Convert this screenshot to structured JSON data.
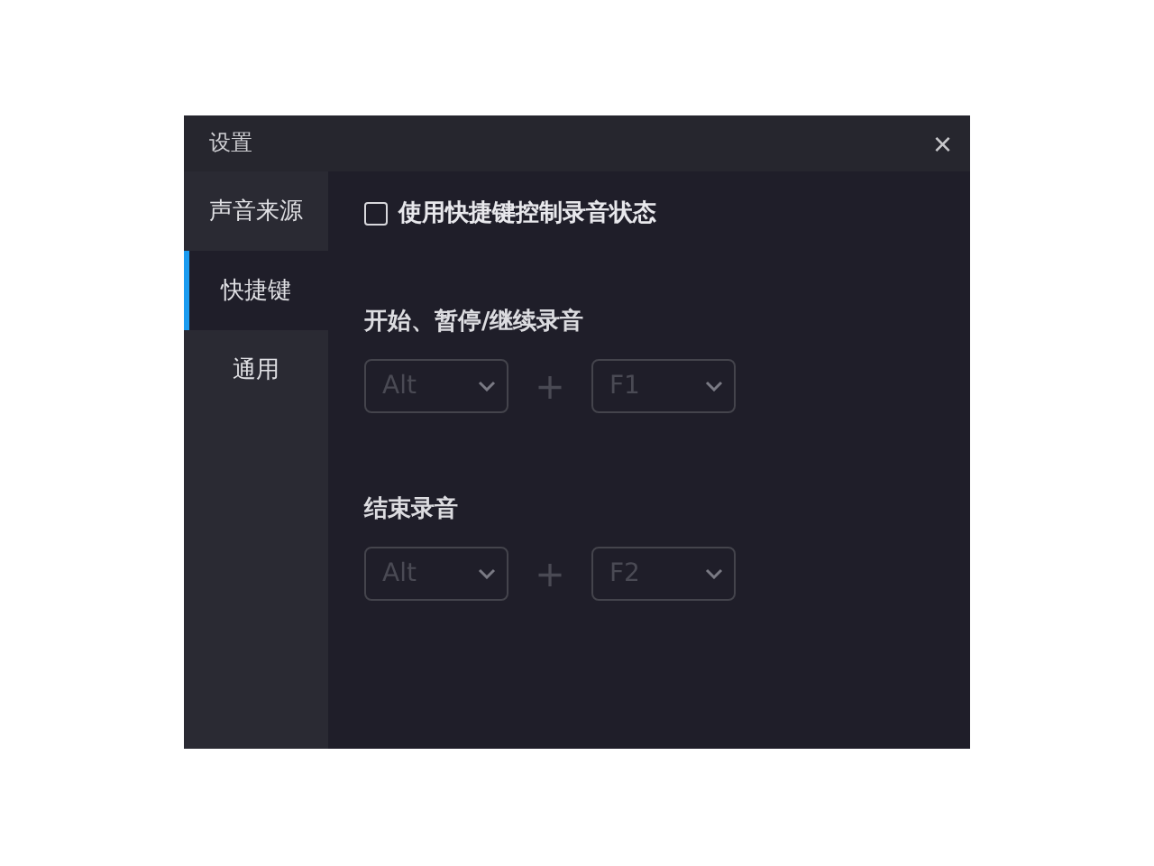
{
  "window": {
    "title": "设置",
    "close": "×"
  },
  "sidebar": {
    "items": [
      {
        "label": "声音来源",
        "selected": false
      },
      {
        "label": "快捷键",
        "selected": true
      },
      {
        "label": "通用",
        "selected": false
      }
    ]
  },
  "hotkey_toggle": {
    "label": "使用快捷键控制录音状态",
    "checked": false
  },
  "shortcuts": [
    {
      "title": "开始、暂停/继续录音",
      "modifier": "Alt",
      "plus": "+",
      "key": "F1",
      "disabled": true
    },
    {
      "title": "结束录音",
      "modifier": "Alt",
      "plus": "+",
      "key": "F2",
      "disabled": true
    }
  ]
}
